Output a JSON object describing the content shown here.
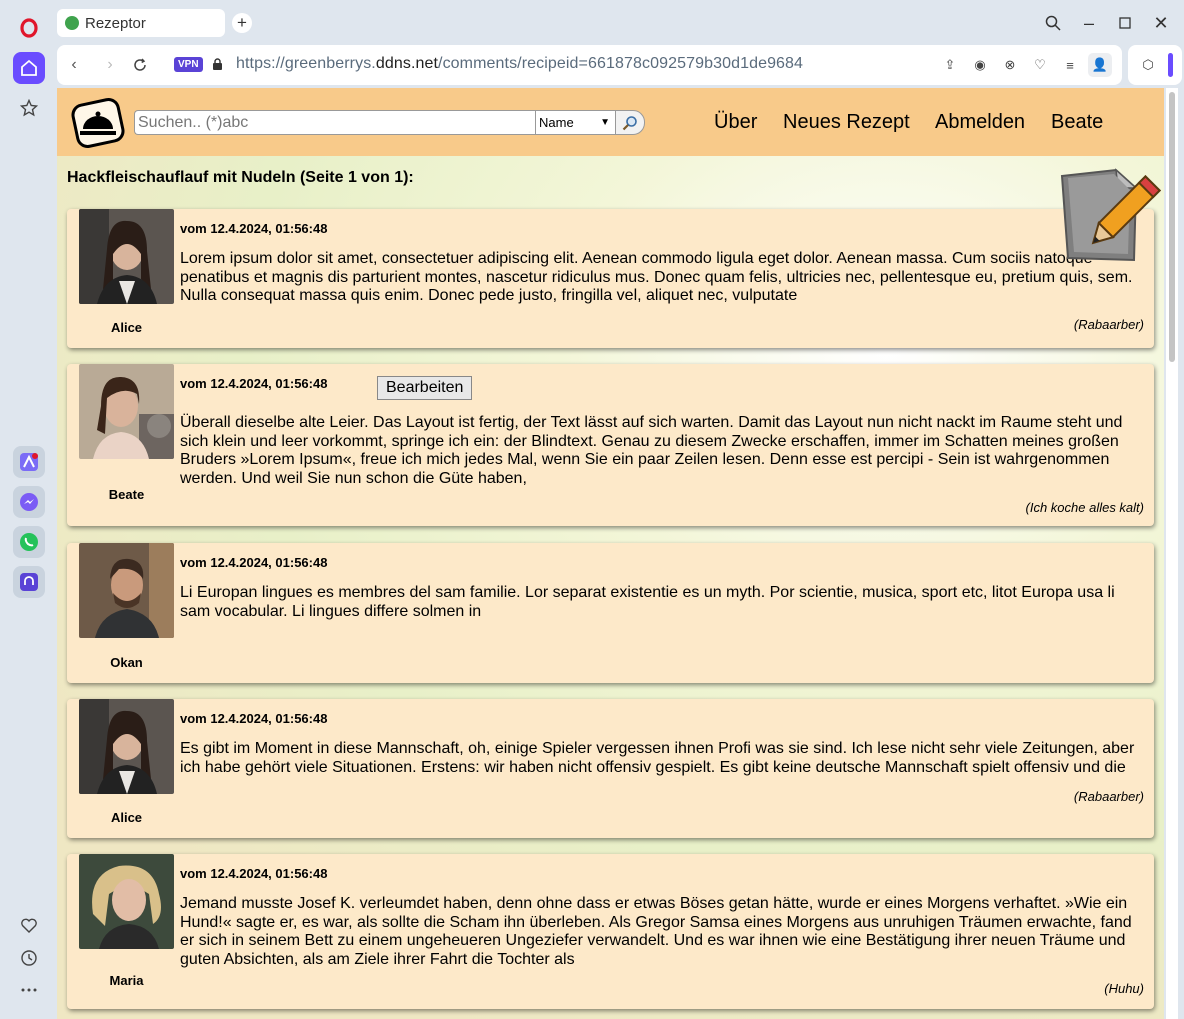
{
  "browser": {
    "tab_title": "Rezeptor",
    "url_prefix": "https://greenberrys.",
    "url_domain": "ddns.net",
    "url_path": "/comments/recipeid=661878c092579b30d1de9684",
    "vpn_label": "VPN"
  },
  "header": {
    "search_placeholder": "Suchen.. (*)abc",
    "search_field_value": "Name",
    "menu": {
      "about": "Über",
      "new_recipe": "Neues Rezept",
      "logout": "Abmelden",
      "user": "Beate"
    }
  },
  "page": {
    "title": "Hackfleischauflauf mit Nudeln  (Seite 1 von 1):"
  },
  "comments": [
    {
      "author": "Alice",
      "date": "vom 12.4.2024, 01:56:48",
      "text": "Lorem ipsum dolor sit amet, consectetuer adipiscing elit. Aenean commodo ligula eget dolor. Aenean massa. Cum sociis natoque penatibus et magnis dis parturient montes, nascetur ridiculus mus. Donec quam felis, ultricies nec, pellentesque eu, pretium quis, sem. Nulla consequat massa quis enim. Donec pede justo, fringilla vel, aliquet nec, vulputate",
      "signature": "(Rabaarber)"
    },
    {
      "author": "Beate",
      "date": "vom 12.4.2024, 01:56:48",
      "edit_label": "Bearbeiten",
      "text": "Überall dieselbe alte Leier. Das Layout ist fertig, der Text lässt auf sich warten. Damit das Layout nun nicht nackt im Raume steht und sich klein und leer vorkommt, springe ich ein: der Blindtext. Genau zu diesem Zwecke erschaffen, immer im Schatten meines großen Bruders »Lorem Ipsum«, freue ich mich jedes Mal, wenn Sie ein paar Zeilen lesen. Denn esse est percipi - Sein ist wahrgenommen werden. Und weil Sie nun schon die Güte haben,",
      "signature": "(Ich koche alles kalt)"
    },
    {
      "author": "Okan",
      "date": "vom 12.4.2024, 01:56:48",
      "text": "Li Europan lingues es membres del sam familie. Lor separat existentie es un myth. Por scientie, musica, sport etc, litot Europa usa li sam vocabular. Li lingues differe solmen in",
      "signature": ""
    },
    {
      "author": "Alice",
      "date": "vom 12.4.2024, 01:56:48",
      "text": "Es gibt im Moment in diese Mannschaft, oh, einige Spieler vergessen ihnen Profi was sie sind. Ich lese nicht sehr viele Zeitungen, aber ich habe gehört viele Situationen. Erstens: wir haben nicht offensiv gespielt. Es gibt keine deutsche Mannschaft spielt offensiv und die",
      "signature": "(Rabaarber)"
    },
    {
      "author": "Maria",
      "date": "vom 12.4.2024, 01:56:48",
      "text": "Jemand musste Josef K. verleumdet haben, denn ohne dass er etwas Böses getan hätte, wurde er eines Morgens verhaftet. »Wie ein Hund!« sagte er, es war, als sollte die Scham ihn überleben. Als Gregor Samsa eines Morgens aus unruhigen Träumen erwachte, fand er sich in seinem Bett zu einem ungeheueren Ungeziefer verwandelt. Und es war ihnen wie eine Bestätigung ihrer neuen Träume und guten Absichten, als am Ziele ihrer Fahrt die Tochter als",
      "signature": "(Huhu)"
    }
  ]
}
